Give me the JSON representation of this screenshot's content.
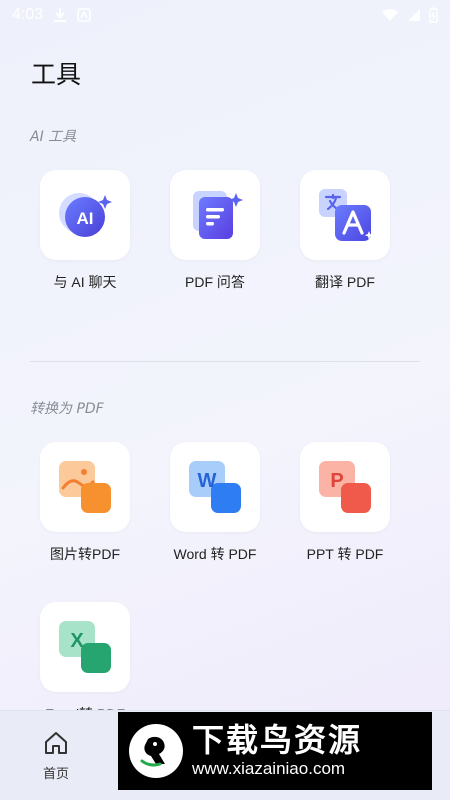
{
  "status_bar": {
    "time": "4:03",
    "icons": [
      "download-icon",
      "app-icon",
      "wifi-icon",
      "signal-icon",
      "battery-icon"
    ]
  },
  "header": {
    "title": "工具"
  },
  "sections": [
    {
      "label": "AI 工具",
      "items": [
        {
          "label": "与 AI 聊天",
          "icon": "ai-chat-icon"
        },
        {
          "label": "PDF 问答",
          "icon": "pdf-qa-icon"
        },
        {
          "label": "翻译 PDF",
          "icon": "translate-icon"
        }
      ]
    },
    {
      "label": "转换为 PDF",
      "items": [
        {
          "label": "图片转PDF",
          "icon": "image-to-pdf-icon"
        },
        {
          "label": "Word 转 PDF",
          "icon": "word-to-pdf-icon"
        },
        {
          "label": "PPT 转 PDF",
          "icon": "ppt-to-pdf-icon"
        },
        {
          "label": "Excel转 PDF",
          "icon": "excel-to-pdf-icon"
        }
      ]
    }
  ],
  "bottom_nav": {
    "home_label": "首页"
  },
  "watermark": {
    "title": "下载鸟资源",
    "url": "www.xiazainiao.com"
  },
  "colors": {
    "ai_blue": "#4b5be8",
    "word_blue": "#3576f0",
    "ppt_red": "#f06553",
    "excel_green": "#2aa876",
    "image_orange": "#f59a3c"
  }
}
